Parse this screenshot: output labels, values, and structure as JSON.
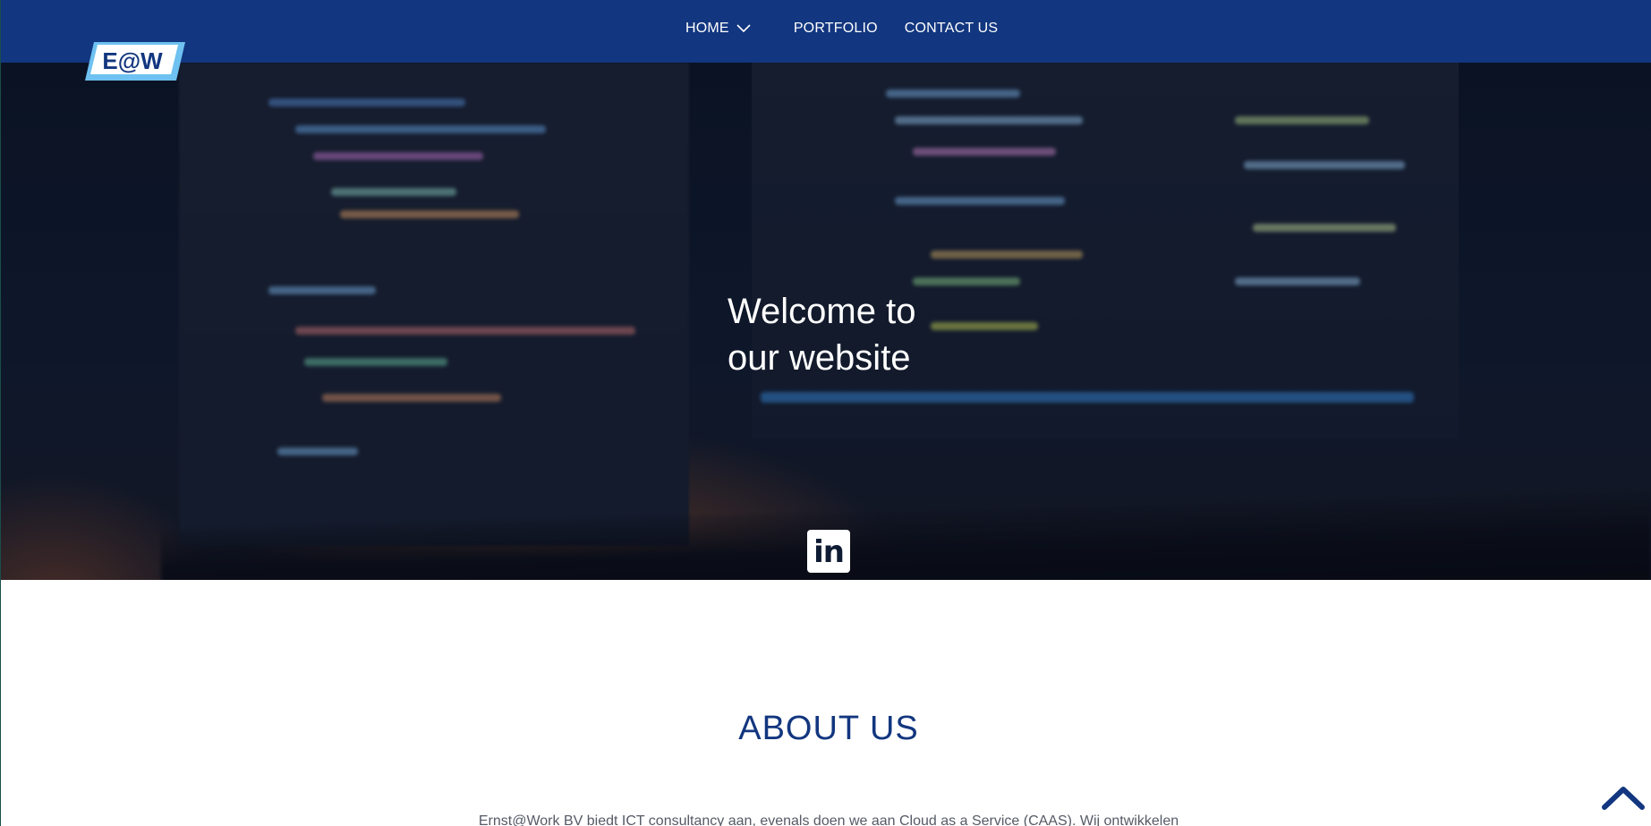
{
  "header": {
    "logo_text": "E@W",
    "nav": {
      "home_label": "HOME",
      "portfolio_label": "PORTFOLIO",
      "contact_label": "CONTACT US"
    }
  },
  "hero": {
    "title_line1": "Welcome to",
    "title_line2": "our website",
    "social_icon": "linkedin-icon"
  },
  "about": {
    "title": "ABOUT US",
    "text": "Ernst@Work BV biedt ICT consultancy aan, evenals doen we aan Cloud as a Service (CAAS). Wij ontwikkelen"
  },
  "colors": {
    "header_bg": "#12367f",
    "accent_light": "#6ec1f0",
    "heading": "#12367f"
  }
}
